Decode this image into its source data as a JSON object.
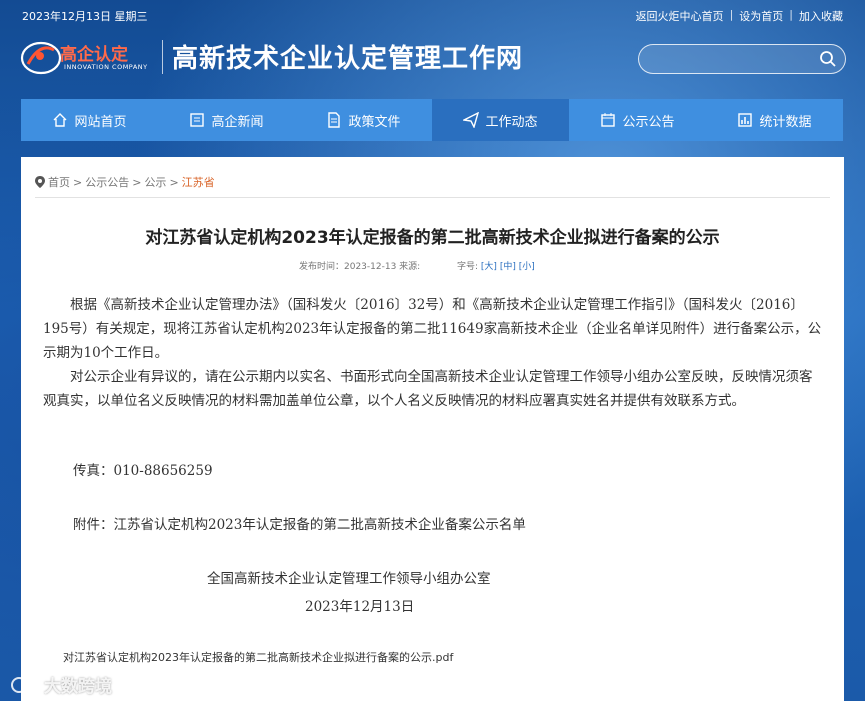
{
  "topbar": {
    "date": "2023年12月13日 星期三",
    "links": [
      "返回火炬中心首页",
      "设为首页",
      "加入收藏"
    ]
  },
  "logo": {
    "text": "高企认定",
    "sub": "INNOVATION COMPANY"
  },
  "site_title": "高新技术企业认定管理工作网",
  "search": {
    "placeholder": ""
  },
  "nav": [
    {
      "label": "网站首页",
      "icon": "home-icon"
    },
    {
      "label": "高企新闻",
      "icon": "news-icon"
    },
    {
      "label": "政策文件",
      "icon": "document-icon"
    },
    {
      "label": "工作动态",
      "icon": "send-icon",
      "active": true
    },
    {
      "label": "公示公告",
      "icon": "notice-icon"
    },
    {
      "label": "统计数据",
      "icon": "chart-icon"
    }
  ],
  "breadcrumb": {
    "items": [
      "首页",
      "公示公告",
      "公示"
    ],
    "current": "江苏省",
    "sep": ">"
  },
  "article": {
    "title": "对江苏省认定机构2023年认定报备的第二批高新技术企业拟进行备案的公示",
    "publish": "发布时间：2023-12-13 来源:",
    "font_size_label": "字号:",
    "font_sizes": [
      "[大]",
      "[中]",
      "[小]"
    ],
    "para1": "根据《高新技术企业认定管理办法》（国科发火〔2016〕32号）和《高新技术企业认定管理工作指引》（国科发火〔2016〕195号）有关规定，现将江苏省认定机构2023年认定报备的第二批11649家高新技术企业（企业名单详见附件）进行备案公示，公示期为10个工作日。",
    "para2": "对公示企业有异议的，请在公示期内以实名、书面形式向全国高新技术企业认定管理工作领导小组办公室反映，反映情况须客观真实，以单位名义反映情况的材料需加盖单位公章，以个人名义反映情况的材料应署真实姓名并提供有效联系方式。",
    "fax": "传真：010-88656259",
    "attachment": "附件：江苏省认定机构2023年认定报备的第二批高新技术企业备案公示名单",
    "sign_org": "全国高新技术企业认定管理工作领导小组办公室",
    "sign_date": "2023年12月13日",
    "file_link": "对江苏省认定机构2023年认定报备的第二批高新技术企业拟进行备案的公示.pdf"
  },
  "watermark": "大数跨境"
}
